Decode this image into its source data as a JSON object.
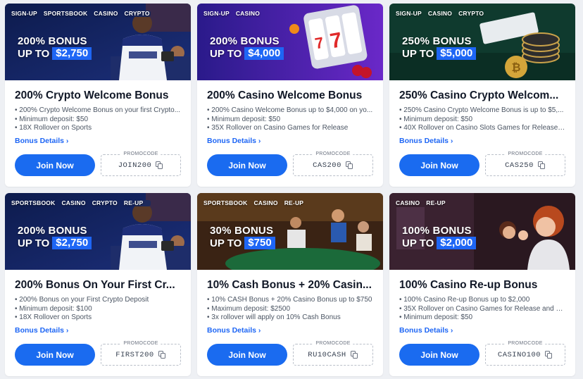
{
  "cards": [
    {
      "tags": [
        "SIGN-UP",
        "SPORTSBOOK",
        "CASINO",
        "CRYPTO"
      ],
      "bonus_line1": "200% BONUS",
      "bonus_up": "UP TO",
      "bonus_amount": "$2,750",
      "title": "200% Crypto Welcome Bonus",
      "lines": [
        "200% Crypto Welcome Bonus on your first Crypto...",
        "Minimum deposit: $50",
        "18X Rollover on Sports"
      ],
      "details": "Bonus Details ›",
      "join": "Join Now",
      "promo_label": "PROMOCODE",
      "promo_code": "JOIN200",
      "theme": "crypto-fan"
    },
    {
      "tags": [
        "SIGN-UP",
        "CASINO"
      ],
      "bonus_line1": "200% BONUS",
      "bonus_up": "UP TO",
      "bonus_amount": "$4,000",
      "title": "200% Casino Welcome Bonus",
      "lines": [
        "200% Casino Welcome Bonus up to $4,000 on yo...",
        "Minimum deposit: $50",
        "35X Rollover on Casino Games for Release"
      ],
      "details": "Bonus Details ›",
      "join": "Join Now",
      "promo_label": "PROMOCODE",
      "promo_code": "CAS200",
      "theme": "slots"
    },
    {
      "tags": [
        "SIGN-UP",
        "CASINO",
        "CRYPTO"
      ],
      "bonus_line1": "250% BONUS",
      "bonus_up": "UP TO",
      "bonus_amount": "$5,000",
      "title": "250% Casino Crypto Welcom...",
      "lines": [
        "250% Casino Crypto Welcome Bonus is up to $5,...",
        "Minimum deposit: $50",
        "40X Rollover on Casino Slots Games for Release ..."
      ],
      "details": "Bonus Details ›",
      "join": "Join Now",
      "promo_label": "PROMOCODE",
      "promo_code": "CAS250",
      "theme": "chips"
    },
    {
      "tags": [
        "SPORTSBOOK",
        "CASINO",
        "CRYPTO",
        "RE-UP"
      ],
      "bonus_line1": "200% BONUS",
      "bonus_up": "UP TO",
      "bonus_amount": "$2,750",
      "title": "200% Bonus On Your First Cr...",
      "lines": [
        "200% Bonus on your First Crypto Deposit",
        "Minimum deposit: $100",
        "18X Rollover on Sports"
      ],
      "details": "Bonus Details ›",
      "join": "Join Now",
      "promo_label": "PROMOCODE",
      "promo_code": "FIRST200",
      "theme": "crypto-fan"
    },
    {
      "tags": [
        "SPORTSBOOK",
        "CASINO",
        "RE-UP"
      ],
      "bonus_line1": "30% BONUS",
      "bonus_up": "UP TO",
      "bonus_amount": "$750",
      "title": "10% Cash Bonus + 20% Casin...",
      "lines": [
        "10% CASH Bonus + 20% Casino Bonus up to $750",
        "Maximum deposit: $2500",
        "3x rollover will apply on 10% Cash Bonus"
      ],
      "details": "Bonus Details ›",
      "join": "Join Now",
      "promo_label": "PROMOCODE",
      "promo_code": "RU10CASH",
      "theme": "sports-bar"
    },
    {
      "tags": [
        "CASINO",
        "RE-UP"
      ],
      "bonus_line1": "100% BONUS",
      "bonus_up": "UP TO",
      "bonus_amount": "$2,000",
      "title": "100% Casino Re-up Bonus",
      "lines": [
        "100% Casino Re-up Bonus up to $2,000",
        "35X Rollover on Casino Games for Release and C...",
        "Minimum deposit: $50"
      ],
      "details": "Bonus Details ›",
      "join": "Join Now",
      "promo_label": "PROMOCODE",
      "promo_code": "CASINO100",
      "theme": "casino-women"
    }
  ],
  "colors": {
    "accent": "#1a6bf0",
    "link": "#1e66f5",
    "page_bg": "#eef0f4"
  }
}
